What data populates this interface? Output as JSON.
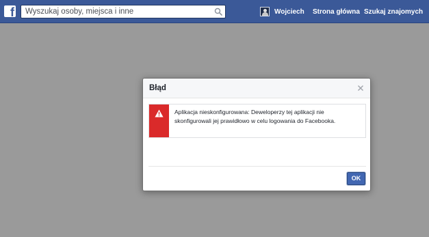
{
  "header": {
    "logo_letter": "f",
    "search": {
      "placeholder": "Wyszukaj osoby, miejsca i inne",
      "value": ""
    },
    "nav": {
      "user_name": "Wojciech",
      "home": "Strona główna",
      "find_friends": "Szukaj znajomych"
    }
  },
  "dialog": {
    "title": "Błąd",
    "close_icon": "close-icon",
    "error_icon": "warning-icon",
    "error_message": "Aplikacja nieskonfigurowana: Deweloperzy tej aplikacji nie skonfigurowali jej prawidłowo w celu logowania do Facebooka.",
    "ok_label": "OK"
  },
  "colors": {
    "brand": "#3b5998",
    "overlay": "#9a9a9a",
    "error": "#da2a2a",
    "button": "#4267b2"
  }
}
